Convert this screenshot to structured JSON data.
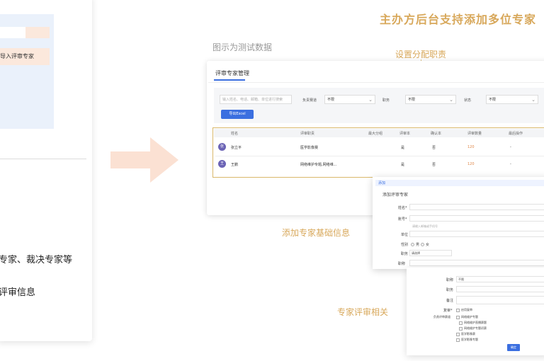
{
  "title": "主办方后台支持添加多位专家",
  "caption": "图示为测试数据",
  "labels": {
    "assign": "设置分配职责",
    "basic": "添加专家基础信息",
    "review": "专家评审相关"
  },
  "left": {
    "import_text": "导入评审专家",
    "line1": "专家、裁决专家等",
    "line2": "评审信息"
  },
  "panel": {
    "title": "评审专家管理",
    "search_placeholder": "输入姓名、电话、邮箱、单位进行搜索",
    "filters": [
      {
        "label": "负责赛道",
        "value": "不限"
      },
      {
        "label": "职务",
        "value": "不限"
      },
      {
        "label": "状态",
        "value": "不限"
      }
    ],
    "import_button": "导出Excel",
    "columns": [
      "姓名",
      "评审职责",
      "最大分组",
      "评审本",
      "确认本",
      "评审数量",
      "最后操作"
    ],
    "rows": [
      {
        "avatar": "张",
        "name": "张立平",
        "duty": "医学影像赛",
        "group": "",
        "book": "是",
        "confirm": "否",
        "count": "120",
        "last": "-"
      },
      {
        "avatar": "王",
        "name": "王鹏",
        "duty": "网络维护专题,网络维...",
        "group": "",
        "book": "是",
        "confirm": "否",
        "count": "120",
        "last": "-"
      }
    ]
  },
  "dialog1": {
    "header": "添加",
    "title": "添加评审专家",
    "fields": [
      "姓名*",
      "账号*",
      "单位",
      "性别",
      "职务",
      "职称"
    ],
    "account_placeholder": "请输入邮箱或手机号",
    "gender_options": [
      "男",
      "女"
    ],
    "duty_value": "请选择"
  },
  "dialog2": {
    "fields": [
      "职称",
      "职务",
      "备注"
    ],
    "duty_value": "不限",
    "review_label": "复审*",
    "review_option": "启用复审",
    "track_label": "负责评审赛道",
    "tracks": [
      "网络维护专题",
      "网络维护直播赛题",
      "网络维护专题初赛",
      "医学影像赛",
      "医学影像专题"
    ],
    "submit": "确定"
  }
}
